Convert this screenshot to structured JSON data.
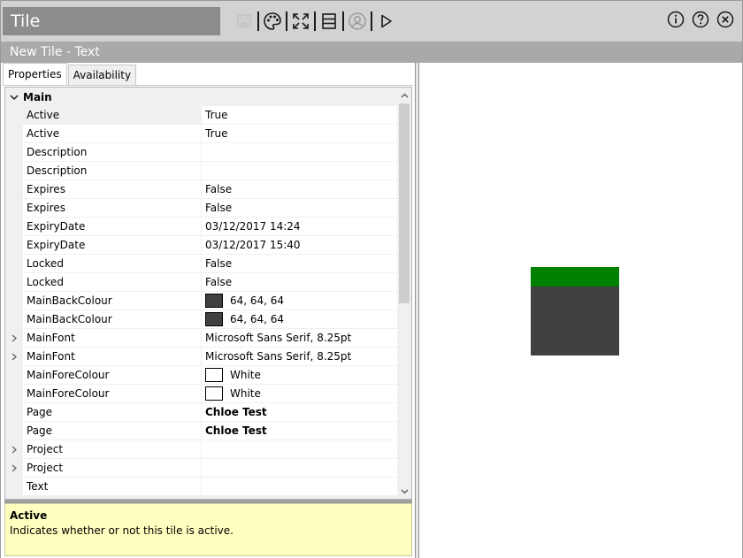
{
  "window": {
    "title": "Tile"
  },
  "subheader": {
    "title": "New Tile - Text"
  },
  "toolbar": {
    "icons": [
      "save-icon",
      "palette-icon",
      "fullscreen-icon",
      "layout-icon",
      "user-icon",
      "play-icon"
    ]
  },
  "tabs": [
    {
      "label": "Properties",
      "active": true
    },
    {
      "label": "Availability",
      "active": false
    }
  ],
  "grid": {
    "category": "Main",
    "rows": [
      {
        "name": "Active",
        "value": "True",
        "expandable": false
      },
      {
        "name": "Active",
        "value": "True",
        "expandable": false
      },
      {
        "name": "Description",
        "value": "",
        "expandable": false
      },
      {
        "name": "Description",
        "value": "",
        "expandable": false
      },
      {
        "name": "Expires",
        "value": "False",
        "expandable": false
      },
      {
        "name": "Expires",
        "value": "False",
        "expandable": false
      },
      {
        "name": "ExpiryDate",
        "value": "03/12/2017 14:24",
        "expandable": false
      },
      {
        "name": "ExpiryDate",
        "value": "03/12/2017 15:40",
        "expandable": false
      },
      {
        "name": "Locked",
        "value": "False",
        "expandable": false
      },
      {
        "name": "Locked",
        "value": "False",
        "expandable": false
      },
      {
        "name": "MainBackColour",
        "value": "64, 64, 64",
        "swatch": "#404040",
        "expandable": false
      },
      {
        "name": "MainBackColour",
        "value": "64, 64, 64",
        "swatch": "#404040",
        "expandable": false
      },
      {
        "name": "MainFont",
        "value": "Microsoft Sans Serif, 8.25pt",
        "expandable": true
      },
      {
        "name": "MainFont",
        "value": "Microsoft Sans Serif, 8.25pt",
        "expandable": true
      },
      {
        "name": "MainForeColour",
        "value": "White",
        "swatch": "#ffffff",
        "expandable": false
      },
      {
        "name": "MainForeColour",
        "value": "White",
        "swatch": "#ffffff",
        "expandable": false
      },
      {
        "name": "Page",
        "value": "Chloe Test",
        "bold": true,
        "expandable": false
      },
      {
        "name": "Page",
        "value": "Chloe Test",
        "bold": true,
        "expandable": false
      },
      {
        "name": "Project",
        "value": "",
        "expandable": true
      },
      {
        "name": "Project",
        "value": "",
        "expandable": true
      },
      {
        "name": "Text",
        "value": "",
        "expandable": false
      }
    ]
  },
  "help": {
    "title": "Active",
    "description": "Indicates whether or not this tile is active."
  },
  "preview": {
    "tile_back_colour": "#404040",
    "tile_bar_colour": "#008000"
  }
}
